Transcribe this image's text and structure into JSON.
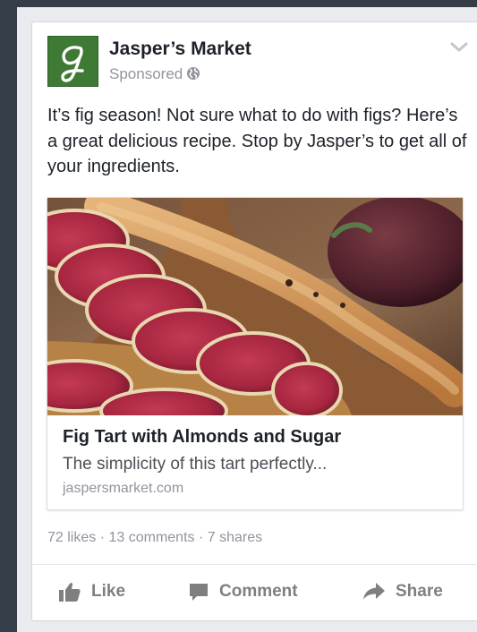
{
  "post": {
    "page_name": "Jasper’s Market",
    "sponsored_label": "Sponsored",
    "text": "It’s fig season! Not sure what to do with figs? Here’s a great delicious recipe. Stop by Jasper’s to get all of your ingredients.",
    "link": {
      "title": "Fig Tart with Almonds and Sugar",
      "description": "The simplicity of this tart perfectly...",
      "domain": "jaspersmarket.com"
    },
    "stats": "72 likes · 13 comments · 7 shares",
    "actions": {
      "like": "Like",
      "comment": "Comment",
      "share": "Share"
    }
  },
  "icons": {
    "avatar": "jaspers-market-logo",
    "privacy": "globe-icon",
    "menu": "chevron-down-icon",
    "like": "thumbs-up-icon",
    "comment": "speech-bubble-icon",
    "share": "share-arrow-icon"
  },
  "colors": {
    "page_background": "#353d48",
    "feed_background": "#e9ebee",
    "card": "#ffffff",
    "brand_green": "#3f7a34",
    "secondary_text": "#90949c",
    "action_text": "#7f7f7f"
  }
}
